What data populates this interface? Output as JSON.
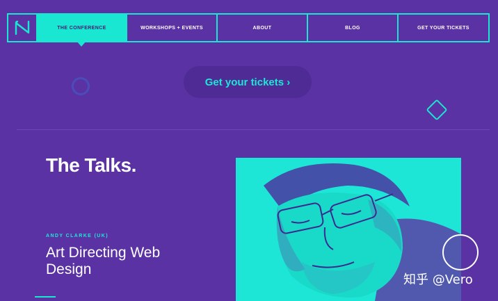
{
  "nav": {
    "logo_icon": "meetup-logo-icon",
    "items": [
      {
        "label": "THE CONFERENCE",
        "active": true
      },
      {
        "label": "WORKSHOPS + EVENTS",
        "active": false
      },
      {
        "label": "ABOUT",
        "active": false
      },
      {
        "label": "BLOG",
        "active": false
      },
      {
        "label": "GET YOUR TICKETS",
        "active": false
      }
    ]
  },
  "cta": {
    "label": "Get your tickets ›"
  },
  "talks": {
    "title": "The Talks.",
    "speaker": "ANDY CLARKE (UK)",
    "talk_title": "Art Directing Web Design"
  },
  "watermark": {
    "text": "知乎 @Vero"
  },
  "colors": {
    "background": "#5b32a3",
    "accent": "#19e7d2",
    "cta_bg": "#4f2b96"
  },
  "icons": {
    "deco_circle": "circle-outline-icon",
    "deco_diamond": "diamond-outline-icon",
    "play": "play-circle-icon"
  }
}
